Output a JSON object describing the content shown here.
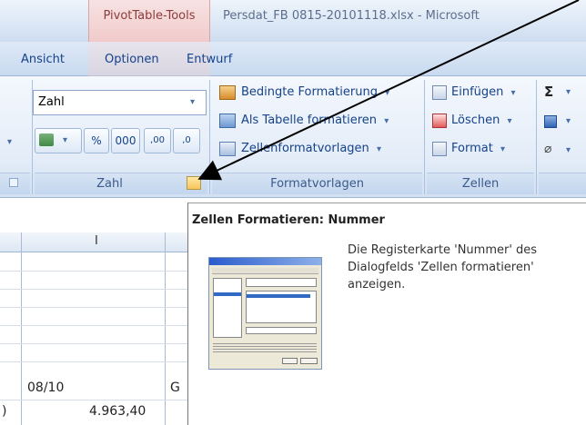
{
  "titlebar": {
    "context_group": "PivotTable-Tools",
    "document_title": "Persdat_FB 0815-20101118.xlsx - Microsoft"
  },
  "tabs": [
    {
      "label": "Ansicht"
    },
    {
      "label": "Optionen"
    },
    {
      "label": "Entwurf"
    }
  ],
  "ribbon": {
    "zahl_group": {
      "label": "Zahl",
      "format_value": "Zahl",
      "percent_label": "%",
      "thousands_label": "000",
      "inc_decimal_label": ",00",
      "dec_decimal_label": ",0"
    },
    "formatvorlagen_group": {
      "label": "Formatvorlagen",
      "items": [
        {
          "label": "Bedingte Formatierung"
        },
        {
          "label": "Als Tabelle formatieren"
        },
        {
          "label": "Zellenformatvorlagen"
        }
      ]
    },
    "zellen_group": {
      "label": "Zellen",
      "items": [
        {
          "label": "Einfügen"
        },
        {
          "label": "Löschen"
        },
        {
          "label": "Format"
        }
      ]
    },
    "editing": {
      "sum_symbol": "Σ"
    }
  },
  "sheet": {
    "column_header": "I",
    "cells": [
      {
        "value": "08/10"
      },
      {
        "value": "G"
      },
      {
        "value": ")"
      },
      {
        "value": "4.963,40"
      }
    ]
  },
  "tooltip": {
    "title": "Zellen Formatieren: Nummer",
    "description": "Die Registerkarte 'Nummer' des Dialogfelds 'Zellen formatieren' anzeigen."
  },
  "colors": {
    "ribbon_text": "#15428b",
    "context_tab": "#8d3b3b",
    "launcher": "#f6c45a"
  }
}
